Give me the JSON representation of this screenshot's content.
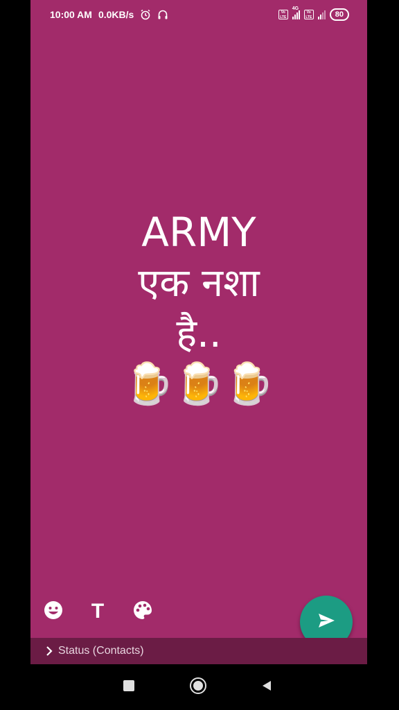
{
  "status_bar": {
    "time": "10:00 AM",
    "network_speed": "0.0KB/s",
    "alarm_icon": "alarm-clock-icon",
    "headset_icon": "headphones-icon",
    "volte_1": "Vo LTE",
    "network_type": "4G",
    "volte_2": "Vo LTE",
    "battery_level": "80"
  },
  "status_content": {
    "line1": "ARMY",
    "line2": "एक नशा",
    "line3": "है..",
    "emoji_line": "🍺🍺🍺",
    "background_color": "#a22b6a",
    "text_color": "#ffffff"
  },
  "tools": {
    "emoji_icon": "smiley-icon",
    "text_tool_label": "T",
    "palette_icon": "palette-icon"
  },
  "send": {
    "icon": "send-icon",
    "color": "#1c9c83"
  },
  "audience": {
    "label": "Status (Contacts)",
    "icon": "chevron-right-icon"
  },
  "nav_bar": {
    "recent_icon": "square-recents-icon",
    "home_icon": "circle-home-icon",
    "back_icon": "triangle-back-icon"
  }
}
